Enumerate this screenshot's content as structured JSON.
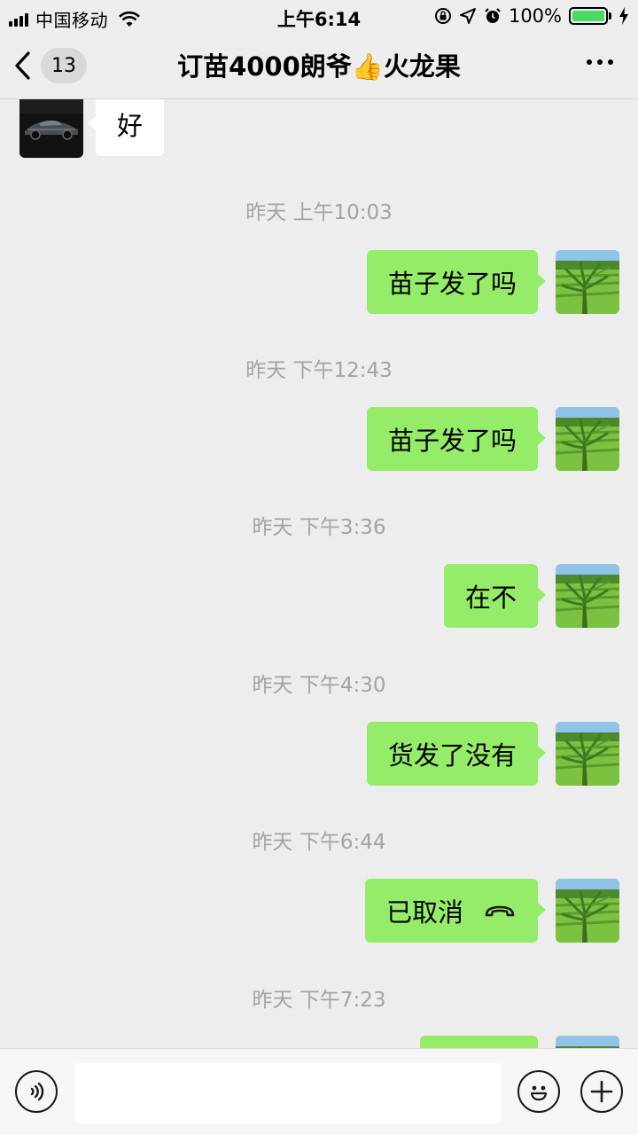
{
  "status_bar": {
    "carrier": "中国移动",
    "time": "上午6:14",
    "battery_text": "100%",
    "battery_level": 1.0
  },
  "nav": {
    "unread_count": "13",
    "title": "订苗4000朗爷👍火龙果"
  },
  "messages": [
    {
      "type": "text",
      "from": "other",
      "text": "好"
    },
    {
      "type": "time",
      "text": "昨天 上午10:03"
    },
    {
      "type": "text",
      "from": "me",
      "text": "苗子发了吗"
    },
    {
      "type": "time",
      "text": "昨天 下午12:43"
    },
    {
      "type": "text",
      "from": "me",
      "text": "苗子发了吗"
    },
    {
      "type": "time",
      "text": "昨天 下午3:36"
    },
    {
      "type": "text",
      "from": "me",
      "text": "在不"
    },
    {
      "type": "time",
      "text": "昨天 下午4:30"
    },
    {
      "type": "text",
      "from": "me",
      "text": "货发了没有"
    },
    {
      "type": "time",
      "text": "昨天 下午6:44"
    },
    {
      "type": "call",
      "from": "me",
      "text": "已取消"
    },
    {
      "type": "time",
      "text": "昨天 下午7:23"
    }
  ],
  "icons": {
    "back": "chevron-left-icon",
    "more": "more-dots-icon",
    "voice": "voice-icon",
    "emoji": "emoji-icon",
    "plus": "plus-icon",
    "call": "phone-hangup-icon"
  },
  "colors": {
    "my_bubble": "#95ec69",
    "other_bubble": "#ffffff",
    "background": "#ededed"
  }
}
